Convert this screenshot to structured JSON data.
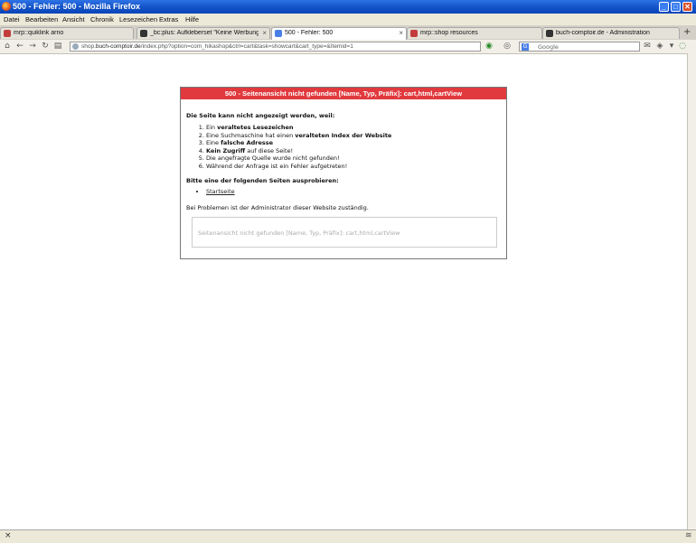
{
  "window": {
    "title": "500 - Fehler: 500 - Mozilla Firefox"
  },
  "menu": [
    "Datei",
    "Bearbeiten",
    "Ansicht",
    "Chronik",
    "Lesezeichen",
    "Extras",
    "Hilfe"
  ],
  "tabs": [
    {
      "label": "mrp::quiklink arno",
      "active": false,
      "color": "#c23c3c"
    },
    {
      "label": "_bc:plus: Aufkleberset \"Keine Werbung\" ...",
      "active": false,
      "color": "#333333"
    },
    {
      "label": "500 - Fehler: 500",
      "active": true,
      "color": "#4a7fe6"
    },
    {
      "label": "mrp::shop resources",
      "active": false,
      "color": "#c23c3c"
    },
    {
      "label": "buch-comptoir.de - Administration",
      "active": false,
      "color": "#333333"
    }
  ],
  "url": {
    "domain_prefix": "shop.",
    "domain": "buch-comptoir.de",
    "path": "/index.php?option=com_hikashop&ctrl=cart&task=showcart&cart_type=&Itemid=1"
  },
  "search": {
    "placeholder": "Google"
  },
  "error": {
    "header": "500 - Seitenansicht nicht gefunden [Name, Typ, Präfix]: cart,html,cartView",
    "reason_title": "Die Seite kann nicht angezeigt werden, weil:",
    "reasons": [
      {
        "prefix": "Ein ",
        "bold": "veraltetes Lesezeichen",
        "suffix": ""
      },
      {
        "prefix": "Eine Suchmaschine hat einen ",
        "bold": "veralteten Index der Website",
        "suffix": ""
      },
      {
        "prefix": "Eine ",
        "bold": "falsche Adresse",
        "suffix": ""
      },
      {
        "prefix": "",
        "bold": "Kein Zugriff",
        "suffix": " auf diese Seite!"
      },
      {
        "prefix": "Die angefragte Quelle wurde nicht gefunden!",
        "bold": "",
        "suffix": ""
      },
      {
        "prefix": "Während der Anfrage ist ein Fehler aufgetreten!",
        "bold": "",
        "suffix": ""
      }
    ],
    "try_title": "Bitte eine der folgenden Seiten ausprobieren:",
    "links": [
      "Startseite"
    ],
    "contact": "Bei Problemen ist der Administrator dieser Website zuständig.",
    "message": "Seitenansicht nicht gefunden [Name, Typ, Präfix]: cart,html,cartView"
  },
  "colors": {
    "error_header": "#e03a3e",
    "titlebar": "#1454c9"
  }
}
